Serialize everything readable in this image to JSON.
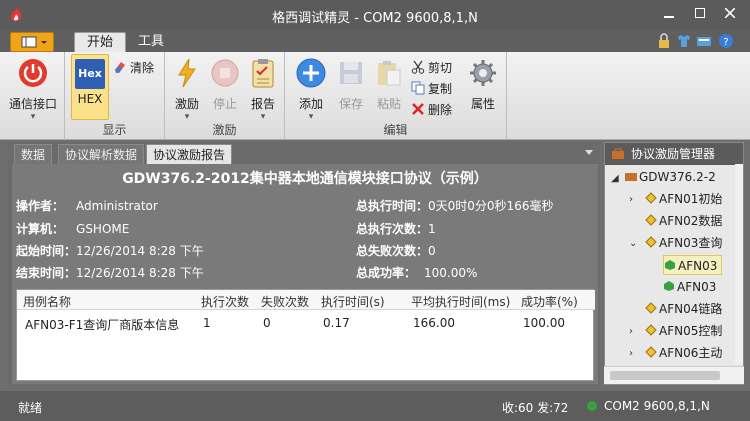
{
  "window": {
    "title": "格西调试精灵 - COM2  9600,8,1,N"
  },
  "ribbon_tabs": [
    {
      "label": "开始"
    },
    {
      "label": "工具"
    }
  ],
  "ribbon": {
    "groups": [
      {
        "label": "显示"
      },
      {
        "label": "激励"
      },
      {
        "label": "编辑"
      }
    ],
    "comm": {
      "label": "通信接口"
    },
    "hex": {
      "icon_text": "Hex",
      "label": "HEX"
    },
    "clear": {
      "label": "清除"
    },
    "stimulate": {
      "label": "激励"
    },
    "stop": {
      "label": "停止"
    },
    "report": {
      "label": "报告"
    },
    "add": {
      "label": "添加"
    },
    "save": {
      "label": "保存"
    },
    "paste": {
      "label": "粘贴"
    },
    "cut": {
      "label": "剪切"
    },
    "copy": {
      "label": "复制"
    },
    "delete": {
      "label": "删除"
    },
    "properties": {
      "label": "属性"
    }
  },
  "doc_tabs": [
    {
      "label": "数据"
    },
    {
      "label": "协议解析数据"
    },
    {
      "label": "协议激励报告"
    }
  ],
  "report": {
    "title": "GDW376.2-2012集中器本地通信模块接口协议（示例）",
    "operator": {
      "key": "操作者：",
      "value": "Administrator"
    },
    "computer": {
      "key": "计算机：",
      "value": "GSHOME"
    },
    "start": {
      "key": "起始时间：",
      "value": "12/26/2014 8:28 下午"
    },
    "end": {
      "key": "结束时间：",
      "value": "12/26/2014 8:28 下午"
    },
    "total_time": {
      "key": "总执行时间：",
      "value": "0天0时0分0秒166毫秒"
    },
    "total_runs": {
      "key": "总执行次数：",
      "value": "1"
    },
    "total_fail": {
      "key": "总失败次数：",
      "value": "0"
    },
    "success_rate": {
      "key": "总成功率：",
      "value": "100.00%"
    }
  },
  "table": {
    "headers": [
      "用例名称",
      "执行次数",
      "失败次数",
      "执行时间(s)",
      "平均执行时间(ms)",
      "成功率(%)"
    ],
    "rows": [
      [
        "AFN03-F1查询厂商版本信息",
        "1",
        "0",
        "0.17",
        "166.00",
        "100.00"
      ]
    ]
  },
  "right_pane": {
    "title": "协议激励管理器",
    "tree": [
      {
        "label": "GDW376.2-2"
      },
      {
        "label": "AFN01初始"
      },
      {
        "label": "AFN02数据"
      },
      {
        "label": "AFN03查询"
      },
      {
        "label": "AFN03"
      },
      {
        "label": "AFN03"
      },
      {
        "label": "AFN04链路"
      },
      {
        "label": "AFN05控制"
      },
      {
        "label": "AFN06主动"
      }
    ]
  },
  "status": {
    "left": "就绪",
    "rx_tx": "收:60  发:72",
    "port": "COM2  9600,8,1,N"
  },
  "colors": {
    "accent": "#f0a419",
    "titlebar": "#5b5b5b",
    "report_bg": "#7a7a7a",
    "tree_selected": "#f5f0c0"
  }
}
